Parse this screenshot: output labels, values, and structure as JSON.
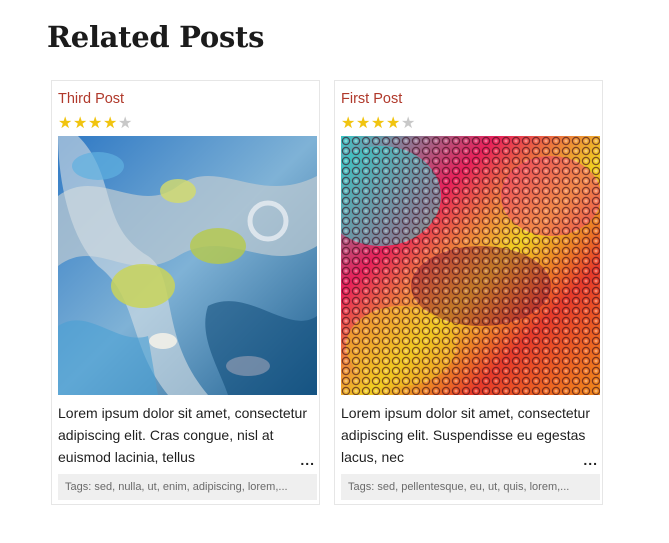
{
  "section": {
    "heading": "Related Posts"
  },
  "posts": [
    {
      "title": "Third Post",
      "rating": 4,
      "rating_max": 5,
      "excerpt": "Lorem ipsum dolor sit amet, consectetur adipiscing elit. Cras congue, nisl at euismod lacinia, tellus",
      "more": "...",
      "tags": "Tags: sed, nulla, ut, enim, adipiscing, lorem,..."
    },
    {
      "title": "First Post",
      "rating": 4,
      "rating_max": 5,
      "excerpt": "Lorem ipsum dolor sit amet, consectetur adipiscing elit. Suspendisse eu egestas lacus, nec",
      "more": "...",
      "tags": "Tags: sed, pellentesque, eu, ut, quis, lorem,..."
    }
  ],
  "icons": {
    "star_filled": "star-filled-icon",
    "star_empty": "star-empty-icon"
  },
  "colors": {
    "title_link": "#b0392b",
    "star_filled": "#f1c40f",
    "star_empty": "#c8c8c8",
    "tags_bg": "#efefef"
  }
}
